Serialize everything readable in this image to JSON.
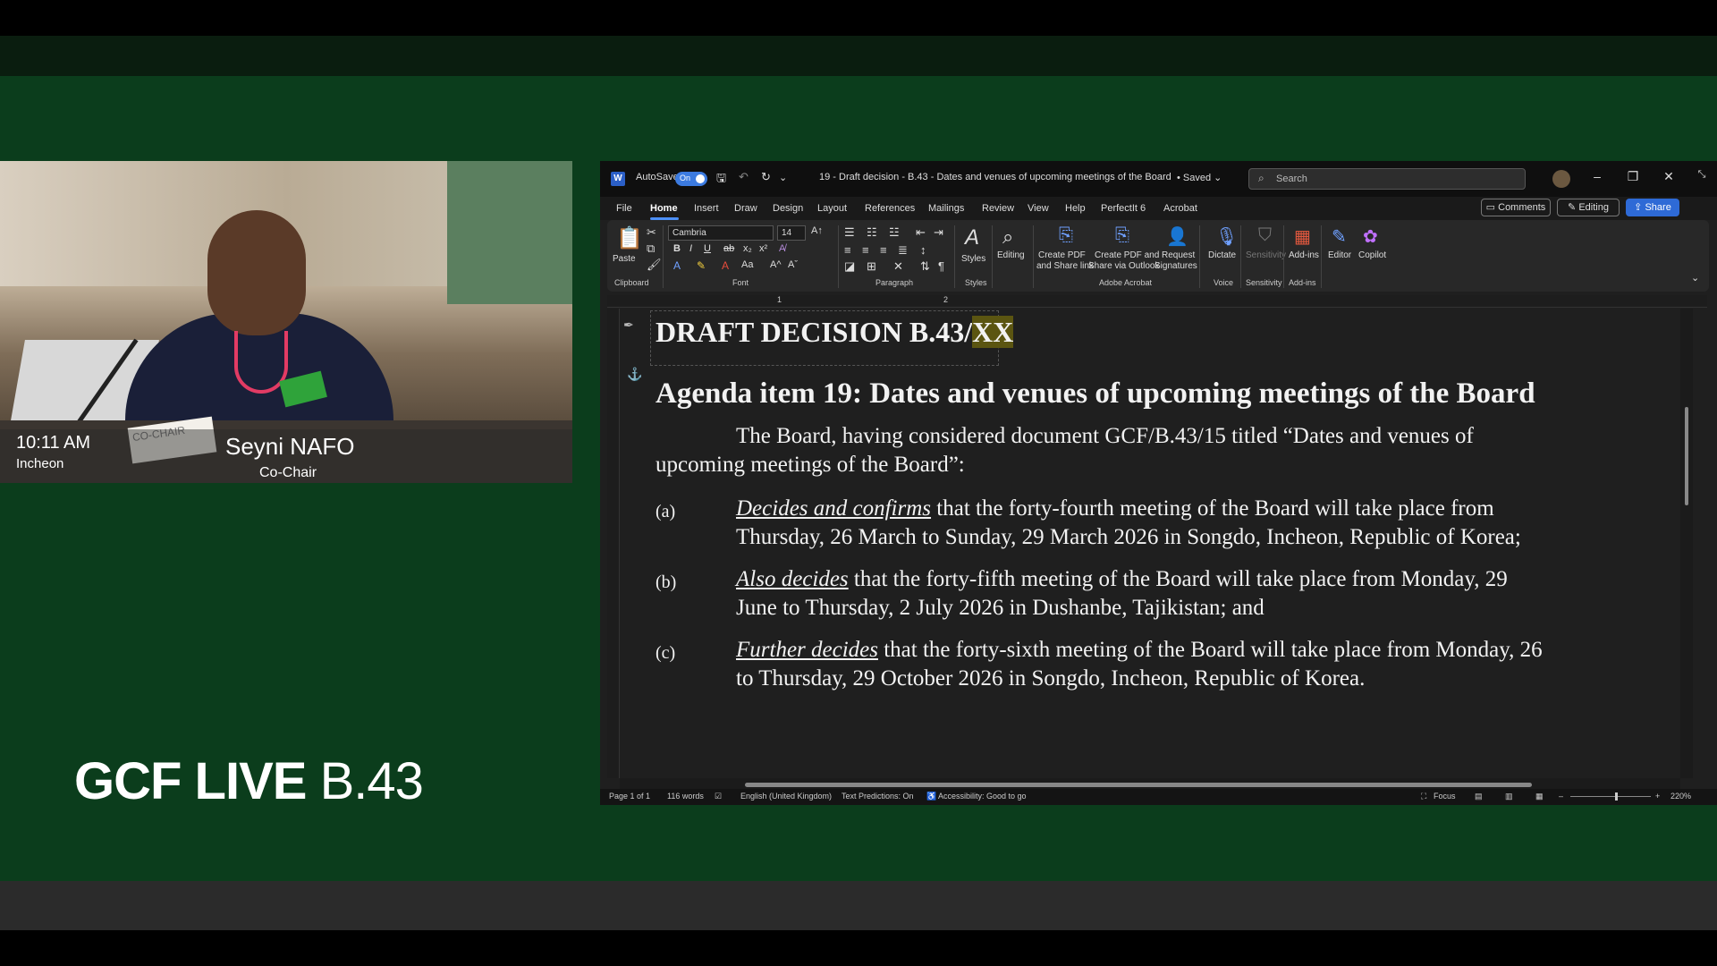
{
  "camera": {
    "time": "10:11 AM",
    "city": "Incheon",
    "speaker_name": "Seyni NAFO",
    "speaker_role": "Co-Chair",
    "placard_text": "CO-CHAIR"
  },
  "brand": {
    "bold": "GCF LIVE",
    "light": " B.43"
  },
  "word": {
    "titlebar": {
      "logo": "W",
      "autosave_label": "AutoSave",
      "autosave_state": "On",
      "doc_title": "19 - Draft decision - B.43 - Dates and venues of upcoming meetings of the Board",
      "saved_state": "• Saved ⌄",
      "search_placeholder": "Search"
    },
    "menu": {
      "items": [
        "File",
        "Home",
        "Insert",
        "Draw",
        "Design",
        "Layout",
        "References",
        "Mailings",
        "Review",
        "View",
        "Help",
        "PerfectIt 6",
        "Acrobat"
      ],
      "comments": "Comments",
      "editing": "Editing",
      "share": "Share"
    },
    "ribbon": {
      "paste": "Paste",
      "font_name": "Cambria",
      "font_size": "14",
      "styles": "Styles",
      "editing": "Editing",
      "create_pdf_share_link": [
        "Create PDF",
        "and Share link"
      ],
      "create_pdf_outlook": [
        "Create PDF and",
        "Share via Outlook"
      ],
      "request_signatures": [
        "Request",
        "Signatures"
      ],
      "dictate": "Dictate",
      "sensitivity": "Sensitivity",
      "addins": "Add-ins",
      "editor": "Editor",
      "copilot": "Copilot",
      "groups": {
        "clipboard": "Clipboard",
        "font": "Font",
        "paragraph": "Paragraph",
        "styles": "Styles",
        "adobe_acrobat": "Adobe Acrobat",
        "voice": "Voice",
        "sensitivity": "Sensitivity",
        "addins": "Add-ins"
      }
    },
    "ruler": {
      "marks": [
        "1",
        "2"
      ]
    },
    "document": {
      "title_main": "DRAFT DECISION B.43/",
      "title_hl": "XX",
      "heading": "Agenda item 19:  Dates and venues of upcoming meetings of the Board",
      "intro_line1": "The Board, having considered document GCF/B.43/15 titled “Dates and venues of",
      "intro_line2": "upcoming meetings of the Board”:",
      "items": [
        {
          "label": "(a)",
          "verb": "Decides and confirms",
          "line1": " that the forty-fourth meeting of the Board will take place from",
          "line2": "Thursday, 26 March to Sunday, 29 March 2026 in Songdo, Incheon, Republic of Korea;"
        },
        {
          "label": "(b)",
          "verb": "Also decides",
          "line1": " that the forty-fifth meeting of the Board will take place from Monday, 29",
          "line2": "June to Thursday, 2 July 2026 in Dushanbe, Tajikistan; and"
        },
        {
          "label": "(c)",
          "verb": "Further decides",
          "line1": " that the forty-sixth meeting of the Board will take place from Monday, 26",
          "line2": "to Thursday, 29 October 2026 in Songdo, Incheon, Republic of Korea."
        }
      ]
    },
    "status": {
      "page": "Page 1 of 1",
      "words": "116 words",
      "language": "English (United Kingdom)",
      "predictions": "Text Predictions: On",
      "accessibility": "Accessibility: Good to go",
      "focus": "Focus",
      "zoom": "220%"
    }
  }
}
